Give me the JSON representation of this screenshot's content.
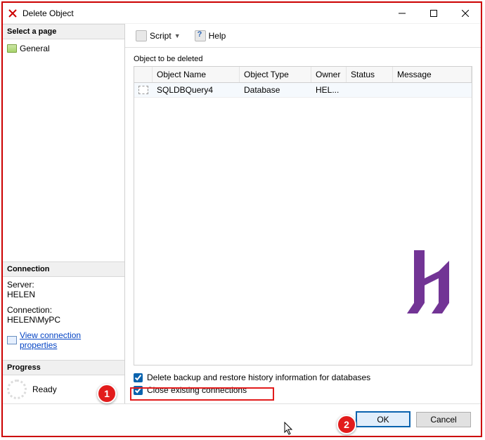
{
  "window": {
    "title": "Delete Object"
  },
  "sidebar": {
    "page_header": "Select a page",
    "pages": [
      {
        "label": "General"
      }
    ],
    "connection_header": "Connection",
    "server_label": "Server:",
    "server_value": "HELEN",
    "conn_label": "Connection:",
    "conn_value": "HELEN\\MyPC",
    "view_props": "View connection properties",
    "progress_header": "Progress",
    "progress_status": "Ready"
  },
  "toolbar": {
    "script": "Script",
    "help": "Help"
  },
  "main": {
    "section_label": "Object to be deleted",
    "columns": {
      "name": "Object Name",
      "type": "Object Type",
      "owner": "Owner",
      "status": "Status",
      "message": "Message"
    },
    "rows": [
      {
        "name": "SQLDBQuery4",
        "type": "Database",
        "owner": "HEL...",
        "status": "",
        "message": ""
      }
    ],
    "check1": "Delete backup and restore history information for databases",
    "check2": "Close existing connections"
  },
  "footer": {
    "ok": "OK",
    "cancel": "Cancel"
  },
  "callouts": {
    "c1": "1",
    "c2": "2"
  }
}
